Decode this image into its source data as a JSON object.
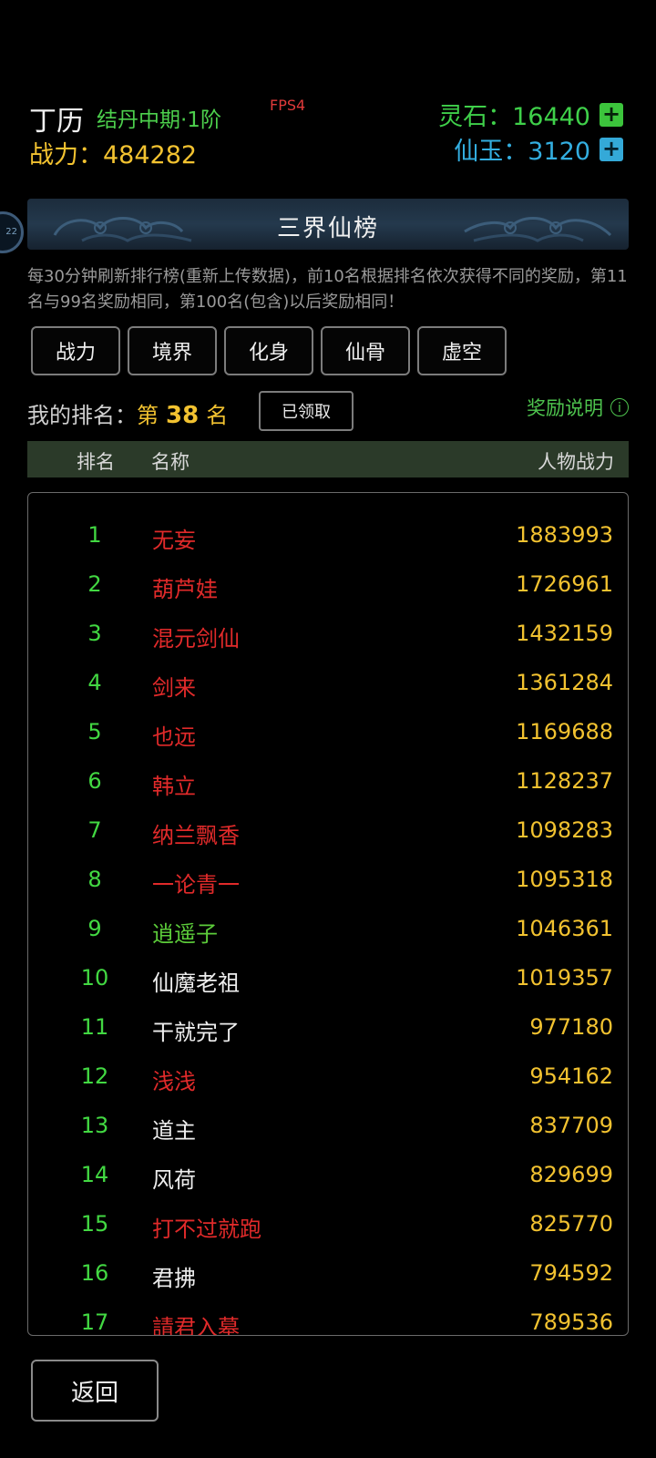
{
  "player": {
    "name": "丁历",
    "realm": "结丹中期·1阶",
    "power_label": "战力：",
    "power_value": "484282"
  },
  "fps": "FPS4",
  "resources": {
    "stone_label": "灵石：",
    "stone_value": "16440",
    "jade_label": "仙玉：",
    "jade_value": "3120",
    "plus": "+"
  },
  "side_badge": "22",
  "banner": {
    "title": "三界仙榜"
  },
  "notice": "每30分钟刷新排行榜(重新上传数据)，前10名根据排名依次获得不同的奖励，第11名与99名奖励相同，第100名(包含)以后奖励相同！",
  "tabs": [
    "战力",
    "境界",
    "化身",
    "仙骨",
    "虚空"
  ],
  "my_rank": {
    "label": "我的排名：",
    "prefix": "第",
    "value": "38",
    "suffix": "名",
    "claim_button": "已领取"
  },
  "reward_link": {
    "label": "奖励说明",
    "icon": "info-icon"
  },
  "table": {
    "headers": {
      "rank": "排名",
      "name": "名称",
      "power": "人物战力"
    },
    "rows": [
      {
        "rank": "1",
        "name": "无妄",
        "power": "1883993",
        "color": "#e02a2a"
      },
      {
        "rank": "2",
        "name": "葫芦娃",
        "power": "1726961",
        "color": "#e02a2a"
      },
      {
        "rank": "3",
        "name": "混元剑仙",
        "power": "1432159",
        "color": "#e02a2a"
      },
      {
        "rank": "4",
        "name": "剑来",
        "power": "1361284",
        "color": "#e02a2a"
      },
      {
        "rank": "5",
        "name": "也远",
        "power": "1169688",
        "color": "#e02a2a"
      },
      {
        "rank": "6",
        "name": "韩立",
        "power": "1128237",
        "color": "#e02a2a"
      },
      {
        "rank": "7",
        "name": "纳兰飘香",
        "power": "1098283",
        "color": "#e02a2a"
      },
      {
        "rank": "8",
        "name": "一论青一",
        "power": "1095318",
        "color": "#e02a2a"
      },
      {
        "rank": "9",
        "name": "逍遥子",
        "power": "1046361",
        "color": "#5ccc3a"
      },
      {
        "rank": "10",
        "name": "仙魔老祖",
        "power": "1019357",
        "color": "#eeeeee"
      },
      {
        "rank": "11",
        "name": "干就完了",
        "power": "977180",
        "color": "#eeeeee"
      },
      {
        "rank": "12",
        "name": "浅浅",
        "power": "954162",
        "color": "#e02a2a"
      },
      {
        "rank": "13",
        "name": "道主",
        "power": "837709",
        "color": "#eeeeee"
      },
      {
        "rank": "14",
        "name": "风荷",
        "power": "829699",
        "color": "#eeeeee"
      },
      {
        "rank": "15",
        "name": "打不过就跑",
        "power": "825770",
        "color": "#e02a2a"
      },
      {
        "rank": "16",
        "name": "君拂",
        "power": "794592",
        "color": "#eeeeee"
      },
      {
        "rank": "17",
        "name": "請君入墓",
        "power": "789536",
        "color": "#e02a2a"
      }
    ]
  },
  "back_button": "返回"
}
